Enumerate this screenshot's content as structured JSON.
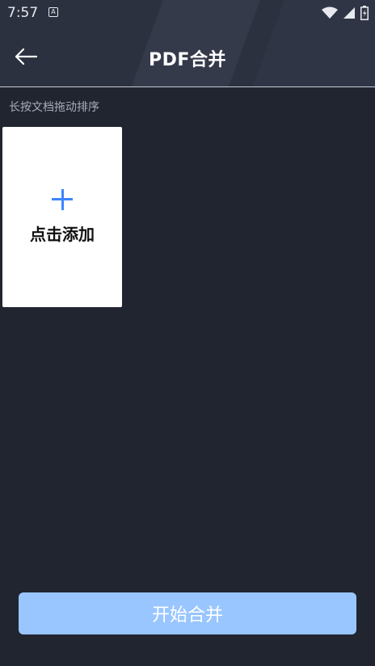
{
  "status_bar": {
    "time": "7:57",
    "notification_icon": "A"
  },
  "header": {
    "title": "PDF合并"
  },
  "hint": "长按文档拖动排序",
  "add_card": {
    "label": "点击添加"
  },
  "start_button": {
    "label": "开始合并"
  },
  "colors": {
    "background": "#212530",
    "header": "#2c3140",
    "accent": "#3c86ff",
    "button": "#99c6ff"
  },
  "icons": [
    "wifi-icon",
    "signal-icon",
    "battery-icon",
    "back-arrow-icon",
    "plus-icon"
  ]
}
